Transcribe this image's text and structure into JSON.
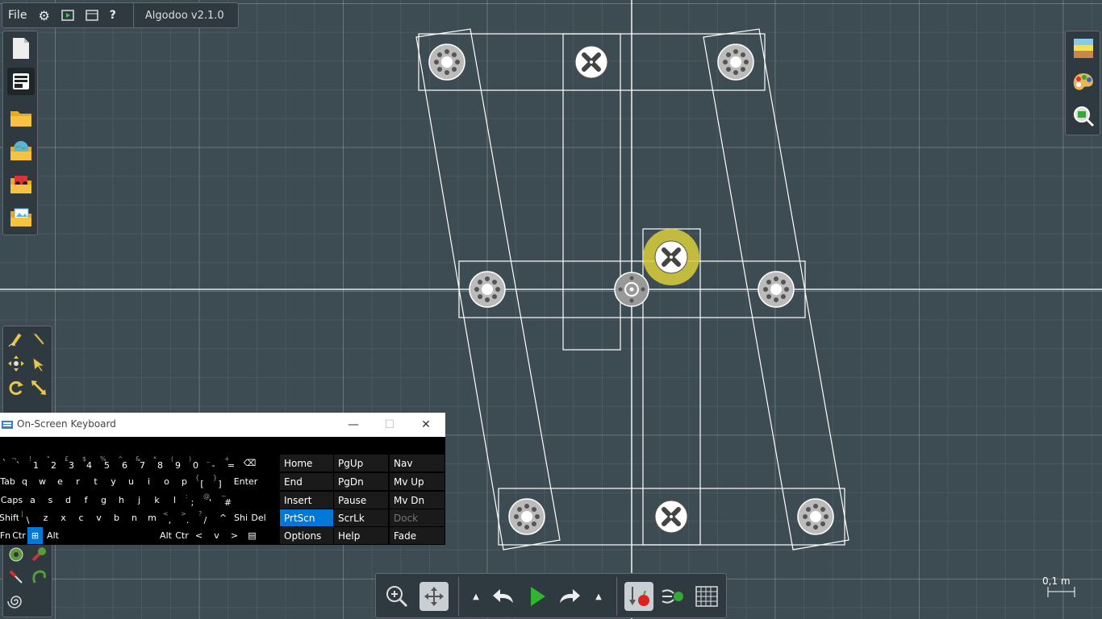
{
  "topbar": {
    "file_label": "File",
    "title": "Algodoo v2.1.0"
  },
  "scale": {
    "label": "0,1 m"
  },
  "osk": {
    "title": "On-Screen Keyboard",
    "rows": [
      [
        {
          "s": "",
          "m": "`"
        },
        {
          "s": "¬",
          "m": "`"
        },
        {
          "s": "!",
          "m": "1"
        },
        {
          "s": "\"",
          "m": "2"
        },
        {
          "s": "£",
          "m": "3"
        },
        {
          "s": "$",
          "m": "4"
        },
        {
          "s": "%",
          "m": "5"
        },
        {
          "s": "^",
          "m": "6"
        },
        {
          "s": "&",
          "m": "7"
        },
        {
          "s": "*",
          "m": "8"
        },
        {
          "s": "(",
          "m": "9"
        },
        {
          "s": ")",
          "m": "0"
        },
        {
          "s": "_",
          "m": "-"
        },
        {
          "s": "+",
          "m": "="
        },
        {
          "s": "",
          "m": "⌫"
        }
      ],
      [
        {
          "s": "",
          "m": "Tab"
        },
        {
          "s": "",
          "m": "q"
        },
        {
          "s": "",
          "m": "w"
        },
        {
          "s": "",
          "m": "e"
        },
        {
          "s": "",
          "m": "r"
        },
        {
          "s": "",
          "m": "t"
        },
        {
          "s": "",
          "m": "y"
        },
        {
          "s": "",
          "m": "u"
        },
        {
          "s": "",
          "m": "i"
        },
        {
          "s": "",
          "m": "o"
        },
        {
          "s": "",
          "m": "p"
        },
        {
          "s": "{",
          "m": "["
        },
        {
          "s": "}",
          "m": "]"
        },
        {
          "s": "",
          "m": "Enter"
        }
      ],
      [
        {
          "s": "",
          "m": "Caps"
        },
        {
          "s": "",
          "m": "a"
        },
        {
          "s": "",
          "m": "s"
        },
        {
          "s": "",
          "m": "d"
        },
        {
          "s": "",
          "m": "f"
        },
        {
          "s": "",
          "m": "g"
        },
        {
          "s": "",
          "m": "h"
        },
        {
          "s": "",
          "m": "j"
        },
        {
          "s": "",
          "m": "k"
        },
        {
          "s": "",
          "m": "l"
        },
        {
          "s": ":",
          "m": ";"
        },
        {
          "s": "@",
          "m": "'"
        },
        {
          "s": "~",
          "m": "#"
        }
      ],
      [
        {
          "s": "",
          "m": "Shift"
        },
        {
          "s": "|",
          "m": "\\"
        },
        {
          "s": "",
          "m": "z"
        },
        {
          "s": "",
          "m": "x"
        },
        {
          "s": "",
          "m": "c"
        },
        {
          "s": "",
          "m": "v"
        },
        {
          "s": "",
          "m": "b"
        },
        {
          "s": "",
          "m": "n"
        },
        {
          "s": "",
          "m": "m"
        },
        {
          "s": "<",
          "m": ","
        },
        {
          "s": ">",
          "m": "."
        },
        {
          "s": "?",
          "m": "/"
        },
        {
          "s": "",
          "m": "^"
        },
        {
          "s": "",
          "m": "Shi"
        },
        {
          "s": "",
          "m": "Del"
        }
      ],
      [
        {
          "s": "",
          "m": "Fn"
        },
        {
          "s": "",
          "m": "Ctr"
        },
        {
          "s": "",
          "m": "⊞"
        },
        {
          "s": "",
          "m": "Alt"
        },
        {
          "s": "",
          "m": ""
        },
        {
          "s": "",
          "m": "Alt"
        },
        {
          "s": "",
          "m": "Ctr"
        },
        {
          "s": "",
          "m": "<"
        },
        {
          "s": "",
          "m": "v"
        },
        {
          "s": "",
          "m": ">"
        },
        {
          "s": "",
          "m": "▤"
        }
      ]
    ],
    "ext": [
      [
        "Home",
        "PgUp",
        "Nav"
      ],
      [
        "End",
        "PgDn",
        "Mv Up"
      ],
      [
        "Insert",
        "Pause",
        "Mv Dn"
      ],
      [
        "PrtScn",
        "ScrLk",
        "Dock"
      ],
      [
        "Options",
        "Help",
        "Fade"
      ]
    ]
  },
  "colors": {
    "background": "#3d4b52",
    "panel": "#2f3940",
    "selection": "#d9cf3a",
    "osk_highlight": "#0078d7"
  }
}
